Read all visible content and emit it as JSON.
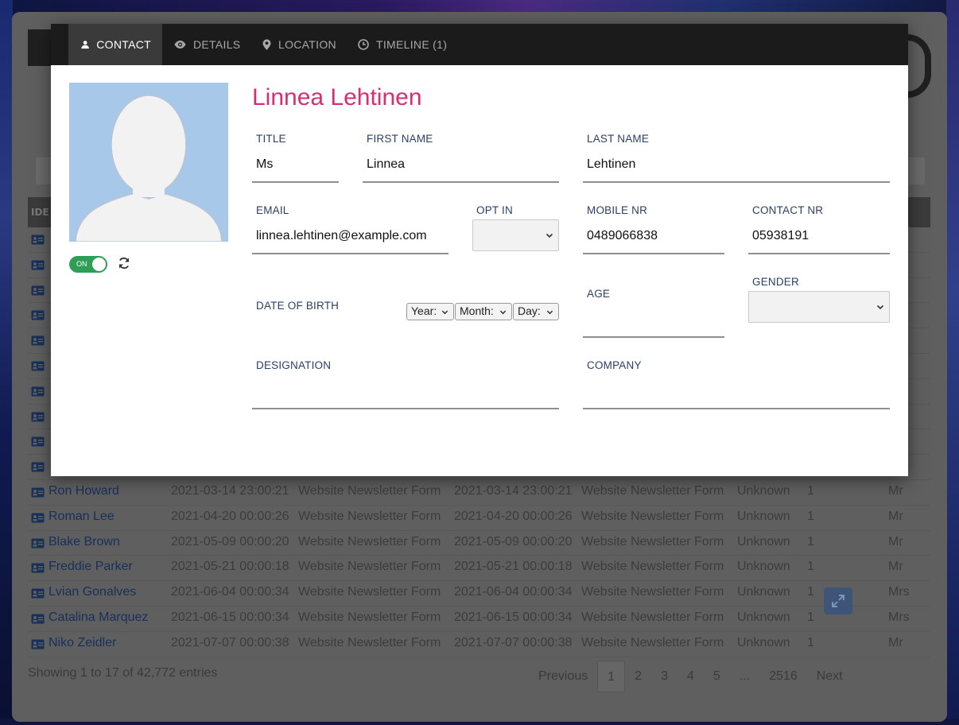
{
  "modal": {
    "tabs": [
      {
        "label": "CONTACT",
        "icon": "user-icon"
      },
      {
        "label": "DETAILS",
        "icon": "eye-icon"
      },
      {
        "label": "LOCATION",
        "icon": "map-marker-icon"
      },
      {
        "label": "TIMELINE (1)",
        "icon": "clock-icon"
      }
    ],
    "contact_name": "Linnea Lehtinen",
    "toggle_label": "ON",
    "fields": {
      "title": {
        "label": "TITLE",
        "value": "Ms"
      },
      "first_name": {
        "label": "FIRST NAME",
        "value": "Linnea"
      },
      "last_name": {
        "label": "LAST NAME",
        "value": "Lehtinen"
      },
      "email": {
        "label": "EMAIL",
        "value": "linnea.lehtinen@example.com"
      },
      "opt_in": {
        "label": "OPT IN",
        "value": ""
      },
      "mobile": {
        "label": "MOBILE NR",
        "value": "0489066838"
      },
      "contact_nr": {
        "label": "CONTACT NR",
        "value": "05938191"
      },
      "dob": {
        "label": "DATE OF BIRTH",
        "year": "Year:",
        "month": "Month:",
        "day": "Day:"
      },
      "age": {
        "label": "AGE",
        "value": ""
      },
      "gender": {
        "label": "GENDER",
        "value": ""
      },
      "designation": {
        "label": "DESIGNATION",
        "value": ""
      },
      "company": {
        "label": "COMPANY",
        "value": ""
      }
    }
  },
  "page": {
    "table_header_first": "IDE",
    "rows": [
      {
        "name": "Ron Howard",
        "created": "2021-03-14 23:00:21",
        "source": "Website Newsletter Form",
        "updated": "2021-03-14 23:00:21",
        "update_source": "Website Newsletter Form",
        "status": "Unknown",
        "count": "1",
        "title": "Mr"
      },
      {
        "name": "Roman Lee",
        "created": "2021-04-20 00:00:26",
        "source": "Website Newsletter Form",
        "updated": "2021-04-20 00:00:26",
        "update_source": "Website Newsletter Form",
        "status": "Unknown",
        "count": "1",
        "title": "Mr"
      },
      {
        "name": "Blake Brown",
        "created": "2021-05-09 00:00:20",
        "source": "Website Newsletter Form",
        "updated": "2021-05-09 00:00:20",
        "update_source": "Website Newsletter Form",
        "status": "Unknown",
        "count": "1",
        "title": "Mr"
      },
      {
        "name": "Freddie Parker",
        "created": "2021-05-21 00:00:18",
        "source": "Website Newsletter Form",
        "updated": "2021-05-21 00:00:18",
        "update_source": "Website Newsletter Form",
        "status": "Unknown",
        "count": "1",
        "title": "Mr"
      },
      {
        "name": "Lvian Gonalves",
        "created": "2021-06-04 00:00:34",
        "source": "Website Newsletter Form",
        "updated": "2021-06-04 00:00:34",
        "update_source": "Website Newsletter Form",
        "status": "Unknown",
        "count": "1",
        "title": "Mrs"
      },
      {
        "name": "Catalina Marquez",
        "created": "2021-06-15 00:00:34",
        "source": "Website Newsletter Form",
        "updated": "2021-06-15 00:00:34",
        "update_source": "Website Newsletter Form",
        "status": "Unknown",
        "count": "1",
        "title": "Mrs"
      },
      {
        "name": "Niko Zeidler",
        "created": "2021-07-07 00:00:38",
        "source": "Website Newsletter Form",
        "updated": "2021-07-07 00:00:38",
        "update_source": "Website Newsletter Form",
        "status": "Unknown",
        "count": "1",
        "title": "Mr"
      }
    ],
    "footer_info": "Showing 1 to 17 of 42,772 entries",
    "pagination": {
      "previous": "Previous",
      "pages": [
        "1",
        "2",
        "3",
        "4",
        "5"
      ],
      "ellipsis": "...",
      "last": "2516",
      "next": "Next"
    }
  }
}
